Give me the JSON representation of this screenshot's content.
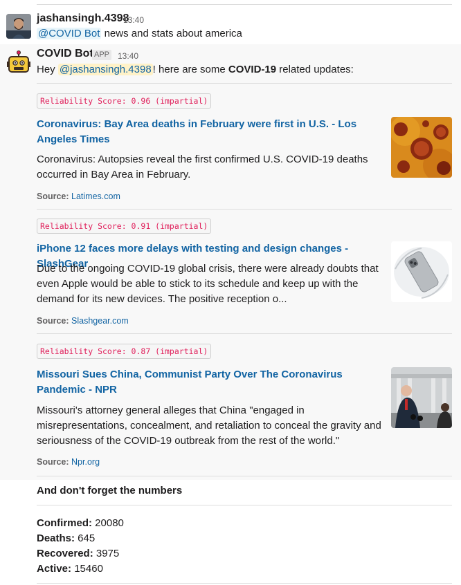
{
  "messages": {
    "user": {
      "name": "jashansingh.4398",
      "time": "13:40",
      "mention": "@COVID Bot",
      "text": " news and stats about america"
    },
    "bot": {
      "name": "COVID Bot",
      "badge": "APP",
      "time": "13:40",
      "intro_prefix": "Hey ",
      "intro_mention": "@jashansingh.4398",
      "intro_mid": "! here are some ",
      "intro_bold": "COVID-19",
      "intro_suffix": " related updates:"
    }
  },
  "articles": [
    {
      "score": "Reliability Score: 0.96 (impartial)",
      "title": "Coronavirus: Bay Area deaths in February were first in U.S. - Los Angeles Times",
      "description": "Coronavirus: Autopsies reveal the first confirmed U.S. COVID-19 deaths occurred in Bay Area in February.",
      "source_label": "Source:",
      "source": "Latimes.com",
      "thumb_icon": "virus-image"
    },
    {
      "score": "Reliability Score: 0.91 (impartial)",
      "title": "iPhone 12 faces more delays with testing and design changes - SlashGear",
      "description": "Due to the ongoing COVID-19 global crisis, there were already doubts that even Apple would be able to stick to its schedule and keep up with the demand for its new devices. The positive reception o...",
      "source_label": "Source:",
      "source": "Slashgear.com",
      "thumb_icon": "phone-image"
    },
    {
      "score": "Reliability Score: 0.87 (impartial)",
      "title": "Missouri Sues China, Communist Party Over The Coronavirus Pandemic - NPR",
      "description": "Missouri's attorney general alleges that China \"engaged in misrepresentations, concealment, and retaliation to conceal the gravity and seriousness of the COVID-19 outbreak from the rest of the world.\"",
      "source_label": "Source:",
      "source": "Npr.org",
      "thumb_icon": "press-conference-image"
    }
  ],
  "numbers": {
    "heading": "And don't forget the numbers",
    "confirmed_label": "Confirmed:",
    "confirmed": " 20080",
    "deaths_label": "Deaths:",
    "deaths": " 645",
    "recovered_label": "Recovered:",
    "recovered": " 3975",
    "active_label": "Active:",
    "active": " 15460"
  },
  "colors": {
    "link": "#1264a3",
    "score_text": "#e01e5a",
    "mention_bg": "#e8f5fa",
    "self_mention_bg": "#fff2c8"
  }
}
